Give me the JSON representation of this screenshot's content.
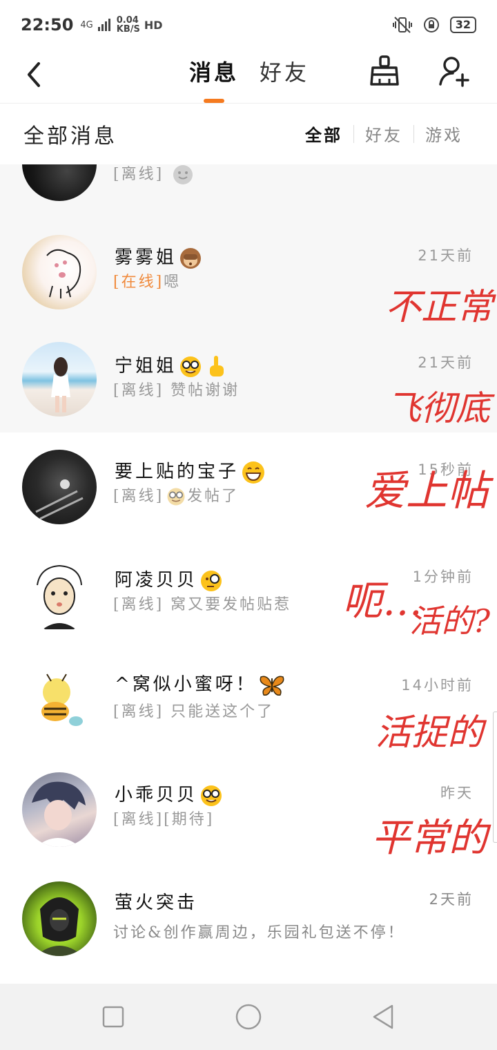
{
  "status_bar": {
    "time": "22:50",
    "network_label": "4G",
    "speed_value": "0.04",
    "speed_unit": "KB/S",
    "hd": "HD",
    "battery": "32"
  },
  "nav": {
    "tabs": [
      {
        "label": "消息",
        "active": true
      },
      {
        "label": "好友",
        "active": false
      }
    ]
  },
  "section": {
    "title": "全部消息",
    "filters": [
      {
        "label": "全部",
        "active": true
      },
      {
        "label": "好友",
        "active": false
      },
      {
        "label": "游戏",
        "active": false
      }
    ]
  },
  "accent_color": "#f57a1f",
  "annotation_color": "#e03530",
  "conversations": [
    {
      "name": "",
      "status": "[离线]",
      "message": "",
      "time": "",
      "emoji": "gray-smile-emoji",
      "note": ""
    },
    {
      "name": "雾雾姐",
      "status": "[在线]",
      "message": "嗯",
      "time": "21天前",
      "emoji": "monkey-emoji",
      "note": "不正常"
    },
    {
      "name": "宁姐姐",
      "status": "[离线]",
      "message": "赞帖谢谢",
      "time": "21天前",
      "emoji": "nerd-pointing-emoji",
      "note": "飞彻底"
    },
    {
      "name": "要上贴的宝子",
      "status": "[离线]",
      "message": "发帖了",
      "time": "15秒前",
      "emoji": "grin-emoji",
      "note": "爱上帖"
    },
    {
      "name": "阿凌贝贝",
      "status": "[离线]",
      "message": "窝又要发帖贴惹",
      "time": "1分钟前",
      "emoji": "monocle-emoji",
      "note": "呃…",
      "note2": "活的?"
    },
    {
      "name": "^窝似小蜜呀！",
      "status": "[离线]",
      "message": "只能送这个了",
      "time": "14小时前",
      "emoji": "butterfly-emoji",
      "note": "活捉的"
    },
    {
      "name": "小乖贝贝",
      "status": "[离线]",
      "message": "[期待]",
      "time": "昨天",
      "emoji": "nerd-emoji",
      "note": "平常的"
    },
    {
      "name": "萤火突击",
      "status": "",
      "message": "讨论&创作赢周边，乐园礼包送不停！",
      "time": "2天前",
      "emoji": "",
      "note": ""
    }
  ]
}
